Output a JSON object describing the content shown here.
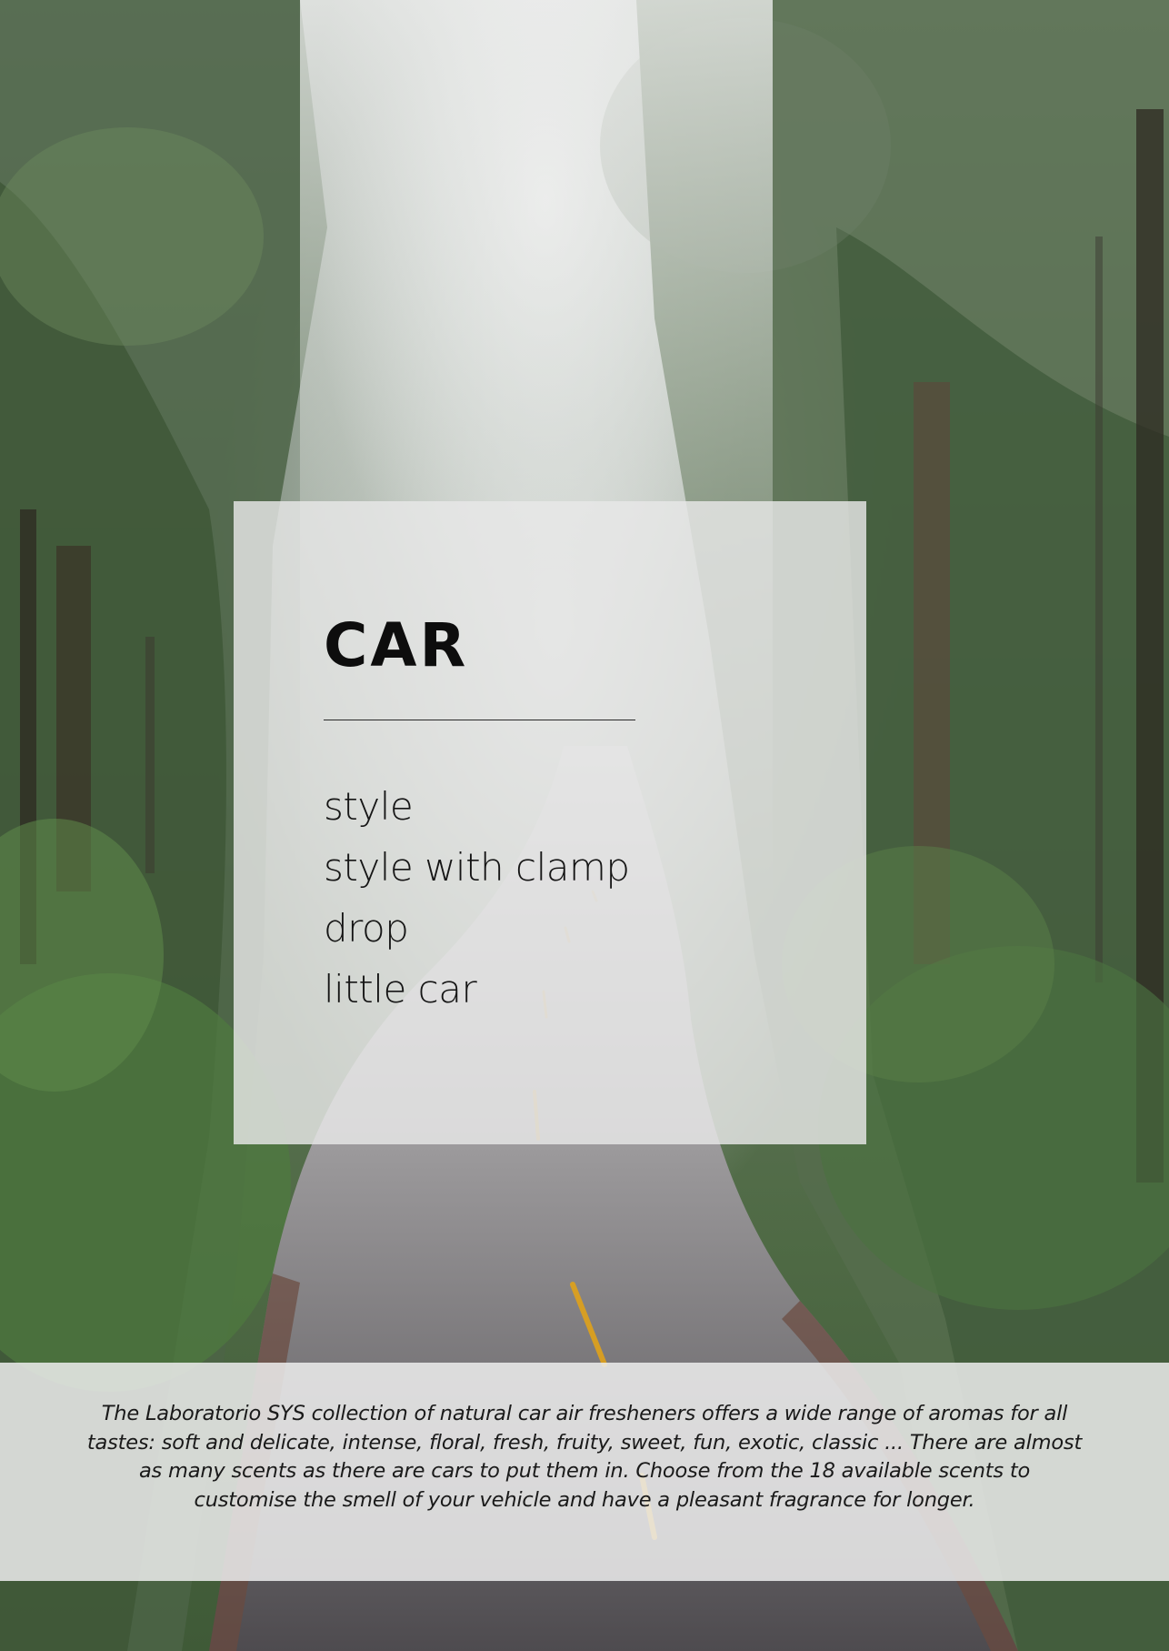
{
  "title": "CAR",
  "variants": [
    "style",
    "style with clamp",
    "drop",
    "little car"
  ],
  "description": "The Laboratorio SYS collection of natural car air fresheners offers a wide range of aromas for all tastes: soft and delicate, intense, floral, fresh, fruity, sweet, fun, exotic, classic ... There are almost as many scents as there are cars to put them in. Choose from the 18 available scents to customise the smell of your vehicle and have a pleasant fragrance for longer.",
  "colors": {
    "title": "#0d0d0d",
    "panel": "#e8e8e8",
    "road_line": "#e0a21a"
  }
}
